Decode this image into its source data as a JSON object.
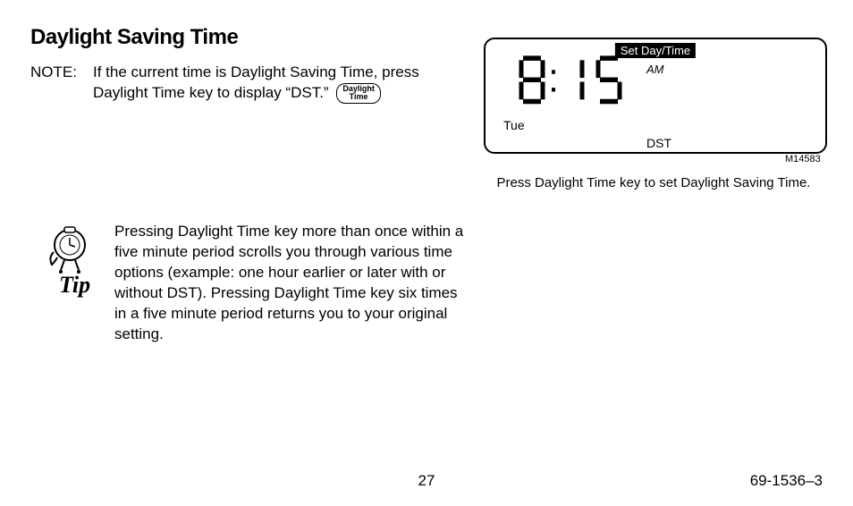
{
  "heading": "Daylight Saving Time",
  "note": {
    "label": "NOTE:",
    "body_line1": "If the current time is Daylight Saving Time, press",
    "body_line2": "Daylight Time key to display “DST.”",
    "key_label_l1": "Daylight",
    "key_label_l2": "Time"
  },
  "tip": {
    "label": "Tip",
    "body": "Pressing Daylight Time key more than once within a five minute period scrolls you through various time options (example: one hour earlier or later with or without DST). Pressing Daylight Time key six times in a five minute period returns you to your original setting."
  },
  "lcd": {
    "mode": "Set Day/Time",
    "time": "8:15",
    "ampm": "AM",
    "day": "Tue",
    "dst": "DST",
    "figure_code": "M14583",
    "caption": "Press Daylight Time key to set Daylight Saving Time."
  },
  "footer": {
    "page": "27",
    "doc": "69-1536–3"
  }
}
